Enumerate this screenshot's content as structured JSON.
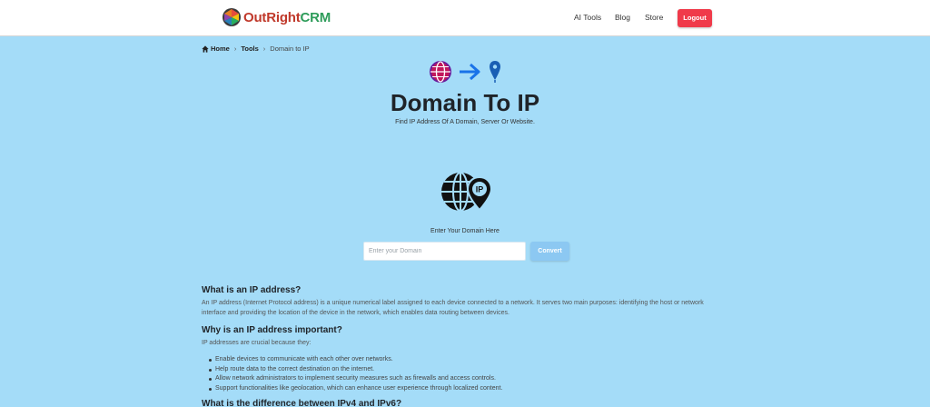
{
  "header": {
    "logo_part1": "OutRight",
    "logo_part2": "CRM",
    "nav": [
      "AI Tools",
      "Blog",
      "Store"
    ],
    "logout": "Logout"
  },
  "breadcrumb": {
    "home": "Home",
    "tools": "Tools",
    "current": "Domain to IP",
    "separator": "›"
  },
  "hero": {
    "title": "Domain To IP",
    "subtitle": "Find IP Address Of A Domain, Server Or Website."
  },
  "form": {
    "label": "Enter Your Domain Here",
    "placeholder": "Enter your Domain",
    "value": "",
    "button": "Convert",
    "big_icon_text": "IP"
  },
  "content": {
    "h1": "What is an IP address?",
    "p1": "An IP address (Internet Protocol address) is a unique numerical label assigned to each device connected to a network. It serves two main purposes: identifying the host or network interface and providing the location of the device in the network, which enables data routing between devices.",
    "h2": "Why is an IP address important?",
    "p2": "IP addresses are crucial because they:",
    "bullets": [
      "Enable devices to communicate with each other over networks.",
      "Help route data to the correct destination on the internet.",
      "Allow network administrators to implement security measures such as firewalls and access controls.",
      "Support functionalities like geolocation, which can enhance user experience through localized content."
    ],
    "h3": "What is the difference between IPv4 and IPv6?"
  },
  "colors": {
    "page_bg": "#a4dcf8",
    "logout_bg": "#f03a4a",
    "convert_bg": "#8cc8f2",
    "arrow": "#1a73e8"
  },
  "icons": [
    "logo-icon",
    "home-icon",
    "globe-icon",
    "arrow-right-icon",
    "location-pin-icon",
    "globe-ip-pin-icon"
  ]
}
